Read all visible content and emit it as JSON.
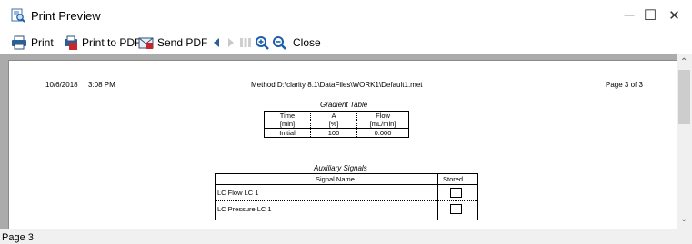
{
  "window": {
    "title": "Print Preview",
    "controls": {
      "minimize": "—",
      "maximize": "☐",
      "close": "✕"
    }
  },
  "toolbar": {
    "print_label": "Print",
    "print_pdf_label": "Print to PDF",
    "send_pdf_label": "Send PDF",
    "close_label": "Close"
  },
  "page": {
    "date": "10/6/2018",
    "time": "3:08 PM",
    "method": "Method D:\\clarity 8.1\\DataFiles\\WORK1\\Default1.met",
    "page_label": "Page 3 of 3"
  },
  "gradient_table": {
    "title": "Gradient Table",
    "headers": [
      {
        "name": "Time",
        "unit": "[min]"
      },
      {
        "name": "A",
        "unit": "[%]"
      },
      {
        "name": "Flow",
        "unit": "[mL/min]"
      }
    ],
    "rows": [
      [
        "Initial",
        "100",
        "0.000"
      ]
    ]
  },
  "aux_signals": {
    "title": "Auxiliary Signals",
    "col_signal": "Signal Name",
    "col_stored": "Stored",
    "rows": [
      {
        "name": "LC Flow LC 1",
        "stored": false
      },
      {
        "name": "LC Pressure LC 1",
        "stored": false
      }
    ]
  },
  "status": {
    "text": "Page 3"
  },
  "colors": {
    "viewer_bg": "#ababab",
    "pdf_red": "#c8262b",
    "zoom_blue": "#1e5ea8"
  }
}
